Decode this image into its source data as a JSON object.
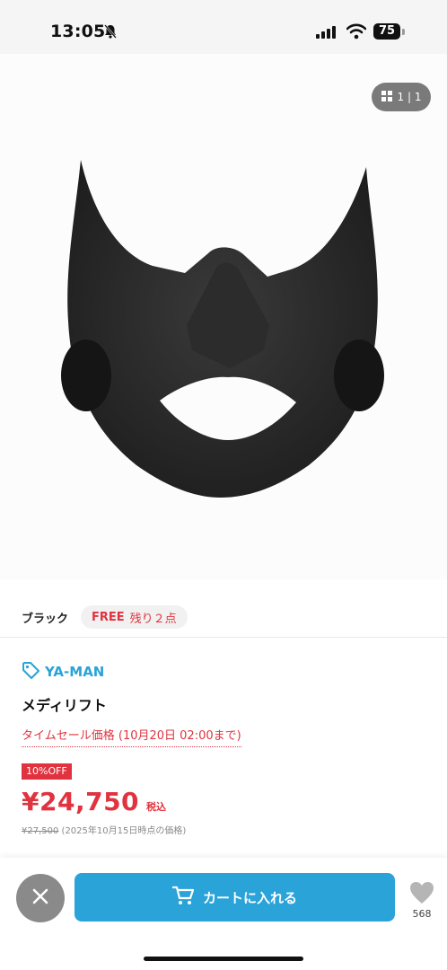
{
  "status_bar": {
    "time": "13:05",
    "battery": "75"
  },
  "gallery": {
    "counter": "1 | 1"
  },
  "variant": {
    "color": "ブラック",
    "size": "FREE",
    "stock": "残り２点"
  },
  "product": {
    "brand": "YA-MAN",
    "name": "メディリフト",
    "sale_label": "タイムセール価格 (10月20日 02:00まで)",
    "discount": "10%OFF",
    "price": "¥24,750",
    "tax": "税込",
    "original_price": "¥27,500",
    "original_note": "(2025年10月15日時点の価格)"
  },
  "actions": {
    "cart_label": "カートに入れる",
    "like_count": "568"
  },
  "colors": {
    "accent": "#2aa3d8",
    "sale": "#e0333f",
    "close_bg": "#8a8a8a"
  },
  "icons": [
    "bell-off-icon",
    "signal-icon",
    "wifi-icon",
    "grid-icon",
    "tag-icon",
    "close-icon",
    "cart-icon",
    "heart-icon"
  ]
}
